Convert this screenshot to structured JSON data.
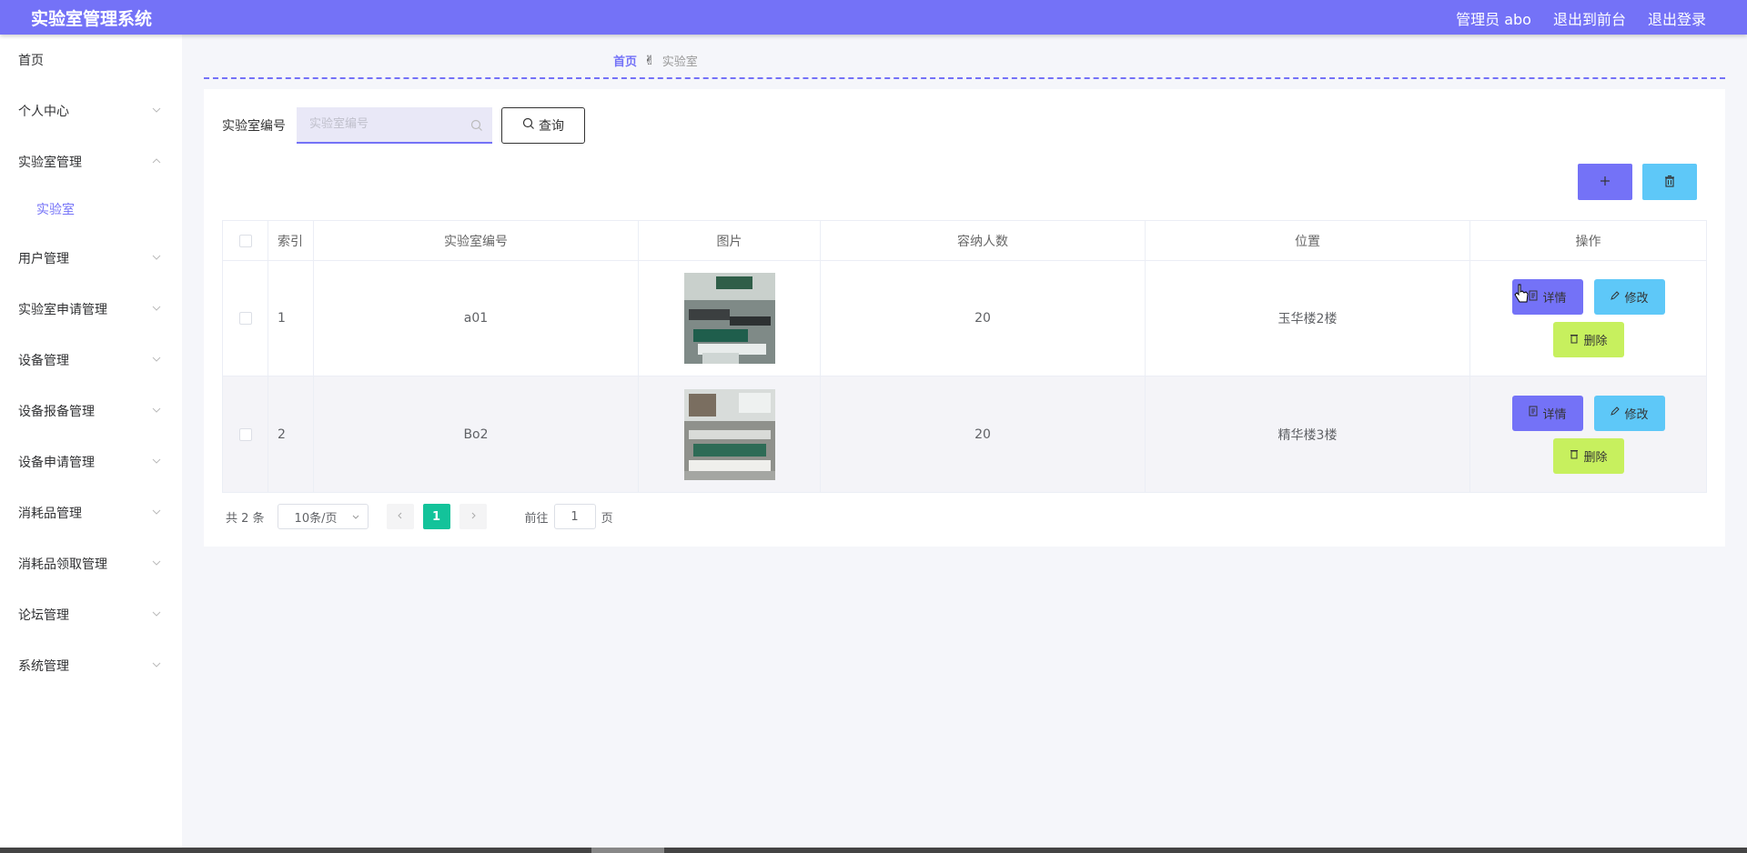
{
  "header": {
    "app_title": "实验室管理系统",
    "user_label": "管理员 abo",
    "front_link": "退出到前台",
    "logout_link": "退出登录",
    "accent_color": "#7472f7"
  },
  "sidebar": {
    "items": [
      {
        "label": "首页"
      },
      {
        "label": "个人中心"
      },
      {
        "label": "实验室管理"
      },
      {
        "label": "实验室"
      },
      {
        "label": "用户管理"
      },
      {
        "label": "实验室申请管理"
      },
      {
        "label": "设备管理"
      },
      {
        "label": "设备报备管理"
      },
      {
        "label": "设备申请管理"
      },
      {
        "label": "消耗品管理"
      },
      {
        "label": "消耗品领取管理"
      },
      {
        "label": "论坛管理"
      },
      {
        "label": "系统管理"
      }
    ]
  },
  "breadcrumb": {
    "home": "首页",
    "current": "实验室"
  },
  "search": {
    "label": "实验室编号",
    "placeholder": "实验室编号",
    "value": "",
    "button_label": "查询"
  },
  "table": {
    "headers": [
      "索引",
      "实验室编号",
      "图片",
      "容纳人数",
      "位置",
      "操作"
    ],
    "rows": [
      {
        "index": "1",
        "lab_no": "a01",
        "capacity": "20",
        "location": "玉华楼2楼"
      },
      {
        "index": "2",
        "lab_no": "Bo2",
        "capacity": "20",
        "location": "精华楼3楼"
      }
    ],
    "actions": {
      "detail": "详情",
      "edit": "修改",
      "delete": "删除"
    }
  },
  "pagination": {
    "total": "共 2 条",
    "page_size": "10条/页",
    "current_page": "1",
    "goto_label": "前往",
    "goto_value": "1",
    "page_unit": "页"
  },
  "colors": {
    "primary": "#7472f7",
    "info": "#5ec8f8",
    "lime": "#c7f05e",
    "success": "#13c39a"
  }
}
